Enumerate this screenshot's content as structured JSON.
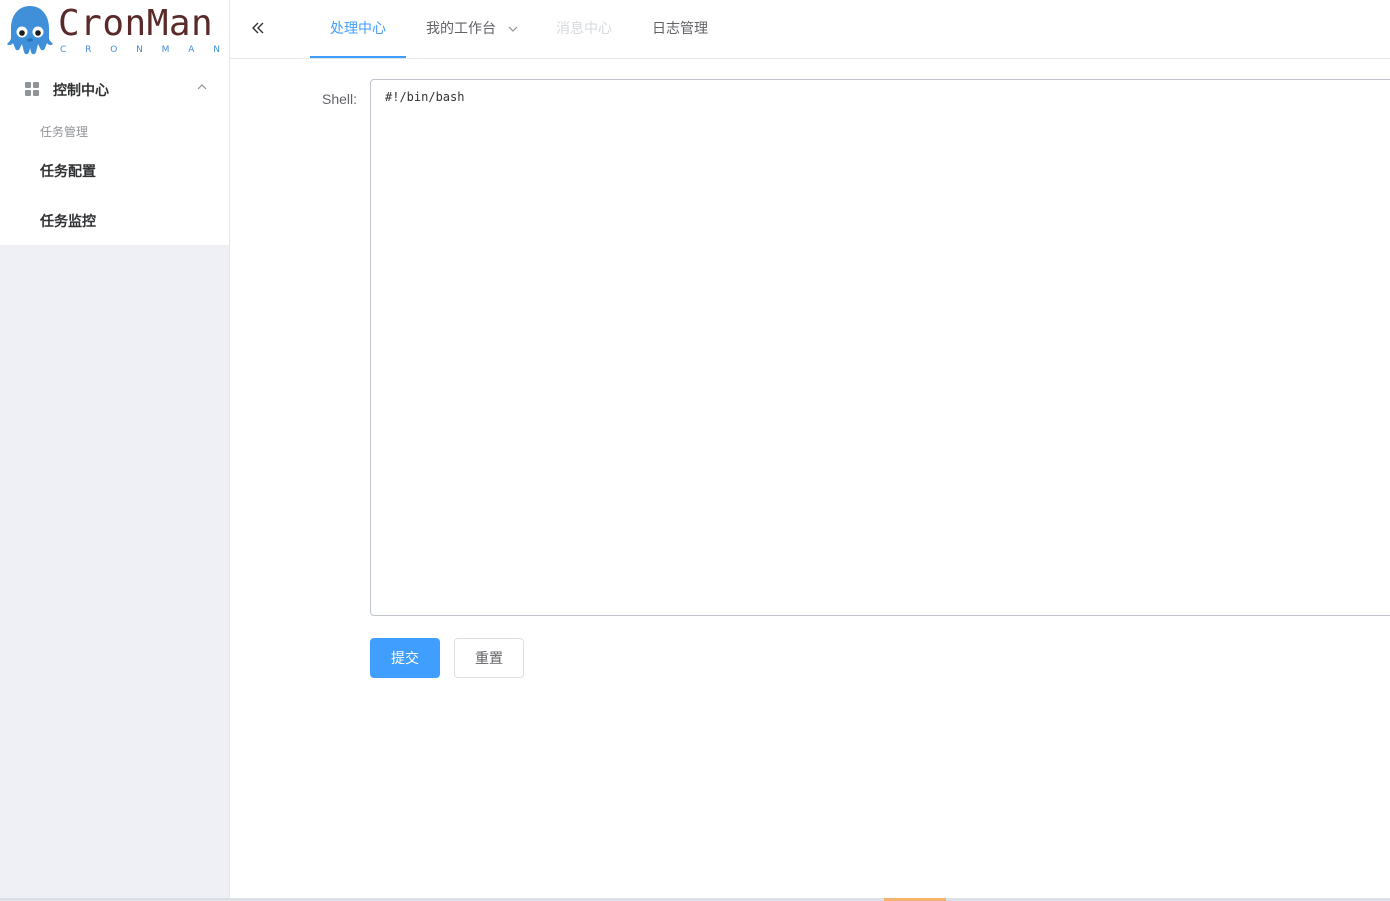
{
  "logo": {
    "title": "CronMan",
    "subtitle_letters": [
      "C",
      "R",
      "O",
      "N",
      "M",
      "A",
      "N"
    ]
  },
  "sidebar": {
    "group_label": "控制中心",
    "sub_label": "任务管理",
    "items": [
      {
        "label": "任务配置"
      },
      {
        "label": "任务监控"
      }
    ]
  },
  "header": {
    "tabs": [
      {
        "label": "处理中心",
        "state": "active"
      },
      {
        "label": "我的工作台",
        "state": "dropdown"
      },
      {
        "label": "消息中心",
        "state": "disabled"
      },
      {
        "label": "日志管理",
        "state": "normal"
      }
    ]
  },
  "form": {
    "shell_label": "Shell:",
    "shell_value": "#!/bin/bash",
    "submit_label": "提交",
    "reset_label": "重置"
  },
  "colors": {
    "accent": "#409eff",
    "sidebar_bg": "#eef0f6",
    "logo_text": "#5a2a2a",
    "logo_mascot": "#3f8fd9"
  },
  "icons": {
    "collapse": "double-chevron-left-icon",
    "group": "grid-icon",
    "group_toggle": "chevron-up-icon",
    "dropdown": "chevron-down-icon"
  }
}
